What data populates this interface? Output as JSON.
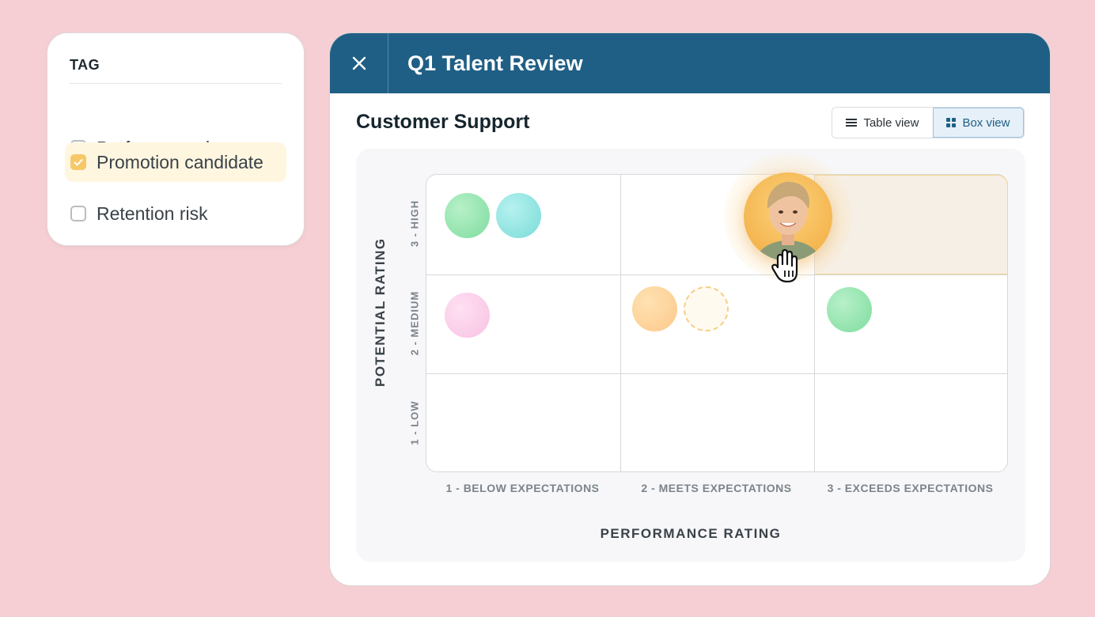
{
  "tag_panel": {
    "header": "TAG",
    "options": [
      {
        "label": "Performance issues",
        "checked": false
      },
      {
        "label": "Promotion candidate",
        "checked": true
      },
      {
        "label": "Retention risk",
        "checked": false
      }
    ]
  },
  "window": {
    "title": "Q1 Talent Review",
    "close_icon": "close-icon",
    "section_title": "Customer Support",
    "view_toggle": {
      "table_label": "Table view",
      "box_label": "Box view",
      "active": "box"
    }
  },
  "grid": {
    "y_axis_label": "POTENTIAL RATING",
    "x_axis_label": "PERFORMANCE RATING",
    "y_ticks": [
      "3 - HIGH",
      "2 - MEDIUM",
      "1 - LOW"
    ],
    "x_ticks": [
      "1 - BELOW EXPECTATIONS",
      "2 - MEETS EXPECTATIONS",
      "3 - EXCEEDS EXPECTATIONS"
    ],
    "highlighted_cell": {
      "performance": 3,
      "potential": 3
    },
    "colors": {
      "title_bar": "#1f5f85",
      "background": "#f5cfd3",
      "accent": "#f6c869"
    }
  }
}
